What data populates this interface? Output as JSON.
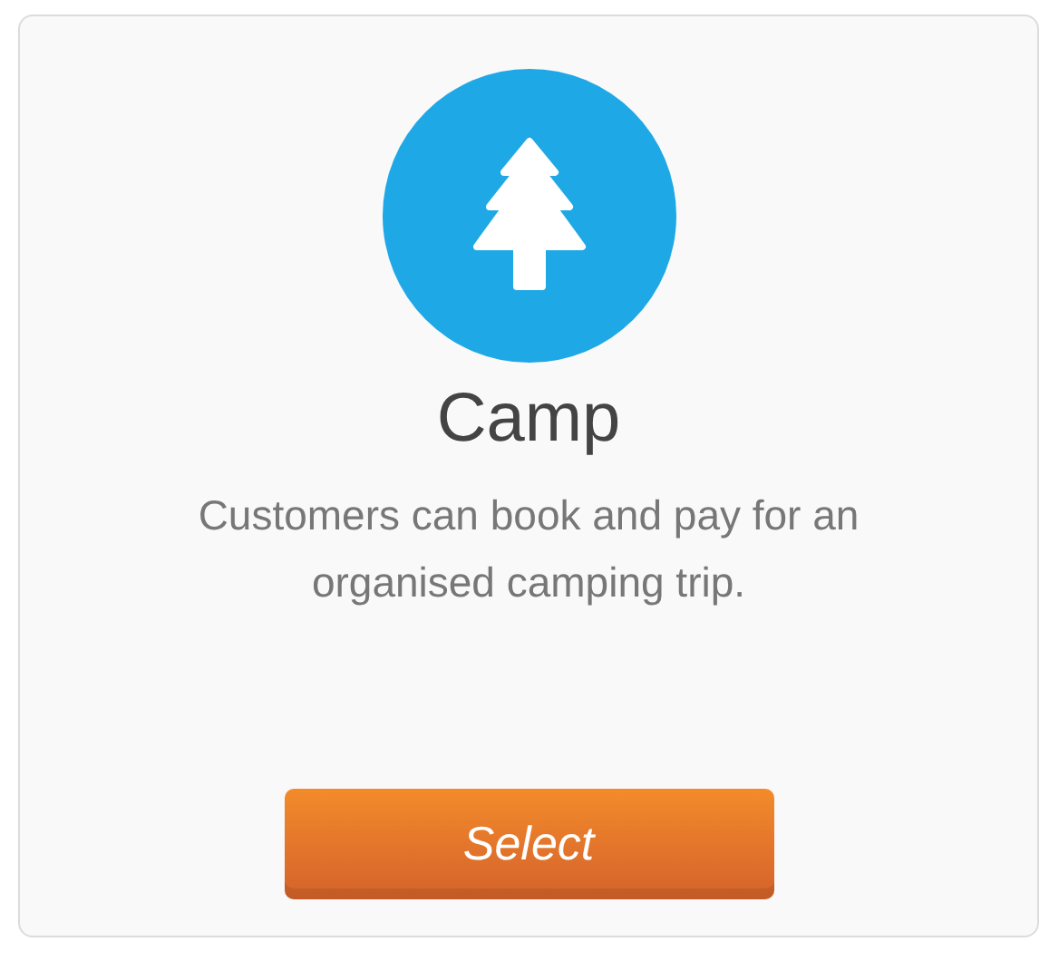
{
  "card": {
    "title": "Camp",
    "description": "Customers can book and pay for an organised camping trip.",
    "button": {
      "label": "Select"
    }
  }
}
